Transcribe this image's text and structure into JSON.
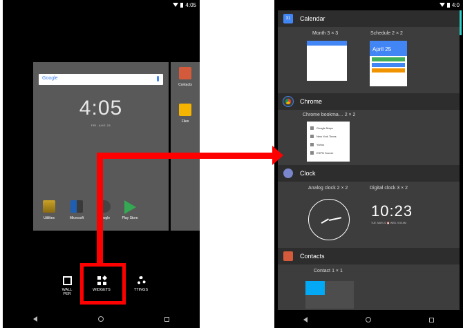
{
  "left_phone": {
    "status_time": "4:05",
    "search_logo": "Google",
    "clock_time": "4:05",
    "clock_date": "FRI, AUG 25",
    "apps": [
      {
        "label": "Utilities",
        "icon": "folder-icon"
      },
      {
        "label": "Microsoft",
        "icon": "folder-icon"
      },
      {
        "label": "Google",
        "icon": "folder-icon"
      },
      {
        "label": "Play Store",
        "icon": "play-store-icon"
      }
    ],
    "side_apps": [
      {
        "label": "Contacts",
        "icon": "contacts-icon"
      },
      {
        "label": "Files",
        "icon": "folder-icon"
      }
    ],
    "menu": {
      "wallpapers_line1": "WALL",
      "wallpapers_line2": "PER",
      "widgets": "WIDGETS",
      "settings": "TTINGS"
    }
  },
  "right_phone": {
    "status_time": "4:0",
    "sections": {
      "calendar": {
        "title": "Calendar",
        "icon_text": "31",
        "month_caption": "Month 3 × 3",
        "schedule_caption": "Schedule 2 × 2",
        "schedule_date": "April 25"
      },
      "chrome": {
        "title": "Chrome",
        "bookmarks_caption": "Chrome bookma… 2 × 2",
        "bookmarks": [
          "Google Maps",
          "New York Times",
          "Yahoo",
          "ESPN Soccer"
        ]
      },
      "clock": {
        "title": "Clock",
        "analog_caption": "Analog clock 2 × 2",
        "digital_caption": "Digital clock 3 × 2",
        "digital_time": "10:23",
        "digital_sub": "TUE, MAR 22 ⏰ WED, 9:30 AM"
      },
      "contacts": {
        "title": "Contacts",
        "contact_caption": "Contact 1 × 1"
      }
    }
  },
  "colors": {
    "highlight": "#ff0000",
    "accent": "#2ad1c9",
    "calendar_blue": "#4285f4"
  }
}
